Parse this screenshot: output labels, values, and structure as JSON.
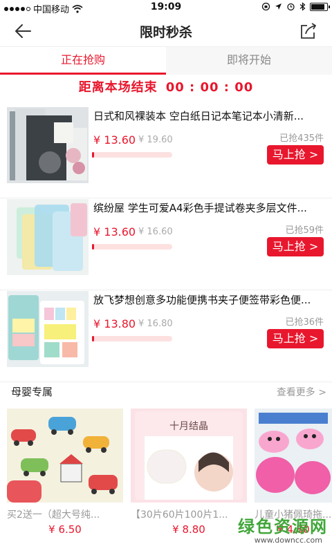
{
  "status_bar": {
    "carrier": "中国移动",
    "time": "19:09"
  },
  "header": {
    "title": "限时秒杀"
  },
  "tabs": [
    {
      "label": "正在抢购",
      "active": true
    },
    {
      "label": "即将开始",
      "active": false
    }
  ],
  "countdown": {
    "label": "距离本场结束",
    "value": "00 : 00 : 00"
  },
  "products": [
    {
      "name": "日式和风裸装本 空白纸日记本笔记本小清新...",
      "price": "¥ 13.60",
      "original_price": "¥ 19.60",
      "sold": "已抢435件",
      "progress": 0.03,
      "buy_label": "马上抢 >"
    },
    {
      "name": "缤纷屋 学生可爱A4彩色手提试卷夹多层文件...",
      "price": "¥ 13.60",
      "original_price": "¥ 16.60",
      "sold": "已抢59件",
      "progress": 0.03,
      "buy_label": "马上抢 >"
    },
    {
      "name": "放飞梦想创意多功能便携书夹子便签带彩色便...",
      "price": "¥ 13.80",
      "original_price": "¥ 16.80",
      "sold": "已抢36件",
      "progress": 0.03,
      "buy_label": "马上抢 >"
    }
  ],
  "section": {
    "title": "母婴专属",
    "more_label": "查看更多 >",
    "items": [
      {
        "title": "买2送一（超大号纯...",
        "price": "¥ 6.50"
      },
      {
        "title": "【30片60片100片1...",
        "price": "¥ 8.80",
        "image_text": "十月结晶"
      },
      {
        "title": "儿童小猪佩琦拖...",
        "price": "¥ 4.80"
      }
    ]
  },
  "watermark": {
    "name": "绿色资源网",
    "url": "www.downcc.com"
  },
  "colors": {
    "accent": "#e8172d",
    "progress_track": "#fde1e1",
    "watermark_green": "#41a63a"
  }
}
